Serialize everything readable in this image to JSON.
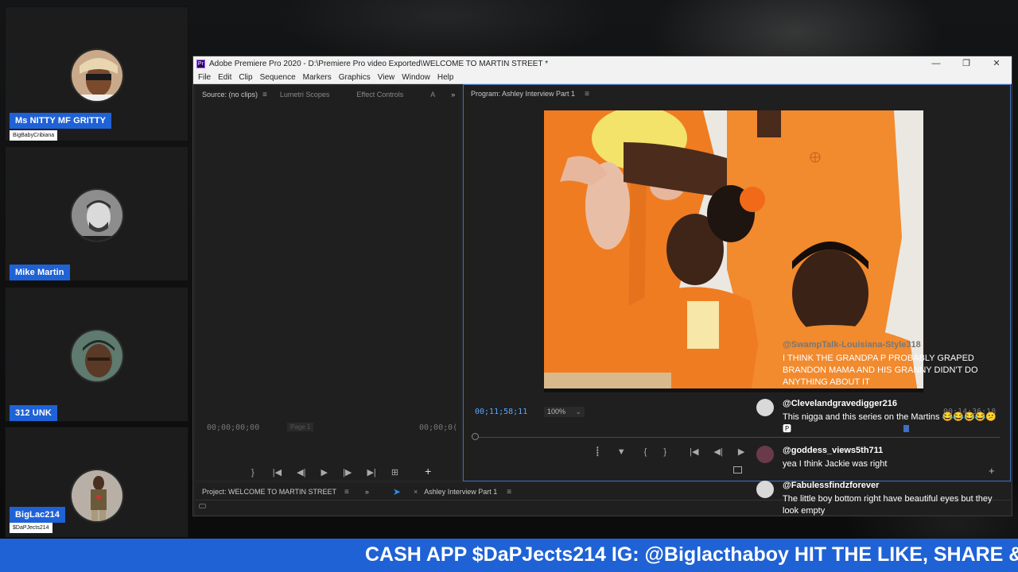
{
  "participants": [
    {
      "name": "Ms NITTY MF GRITTY",
      "handle": "BigBabyCribiana"
    },
    {
      "name": "Mike Martin",
      "handle": ""
    },
    {
      "name": "312 UNK",
      "handle": ""
    },
    {
      "name": "BigLac214",
      "handle": "$DaPJects214"
    }
  ],
  "premiere": {
    "window_title": "Adobe Premiere Pro 2020 - D:\\Premiere Pro video Exported\\WELCOME TO MARTIN STREET *",
    "logo": "Pr",
    "menu": [
      "File",
      "Edit",
      "Clip",
      "Sequence",
      "Markers",
      "Graphics",
      "View",
      "Window",
      "Help"
    ],
    "source_tabs": [
      "Source: (no clips)",
      "Lumetri Scopes",
      "Effect Controls",
      "A"
    ],
    "source_timecode_left": "00;00;00;00",
    "source_timecode_right": "00;00;0(",
    "source_page": "Page 1",
    "program_title": "Program: Ashley Interview Part 1",
    "program_timecode": "00;11;58;11",
    "zoom": "100%",
    "program_duration": "00:14:36:18",
    "project_tab": "Project: WELCOME TO MARTIN STREET",
    "sequence_tab": "Ashley Interview Part 1"
  },
  "chat": {
    "faded_author": "@SwampTalk-Louisiana-Style318",
    "messages": [
      {
        "author": "",
        "text": "I THINK THE GRANDPA P PROBABLY GRAPED BRANDON MAMA AND HIS GRANNY DIDN'T DO ANYTHING ABOUT IT"
      },
      {
        "author": "@Clevelandgravedigger216",
        "text": "This nigga and this series on the Martins 😂😂😂😂😕🅿"
      },
      {
        "author": "@goddess_views5th711",
        "text": "yea I think Jackie was right"
      },
      {
        "author": "@Fabulessfindzforever",
        "text": "The little boy bottom right have beautiful eyes but they look empty"
      }
    ]
  },
  "ticker": {
    "text": "CASH APP $DaPJects214 IG: @Biglacthaboy HIT THE LIKE, SHARE &"
  },
  "colors": {
    "accent": "#1f62d6",
    "program_blue": "#5aa5ff",
    "shirt_orange": "#f07c22"
  }
}
